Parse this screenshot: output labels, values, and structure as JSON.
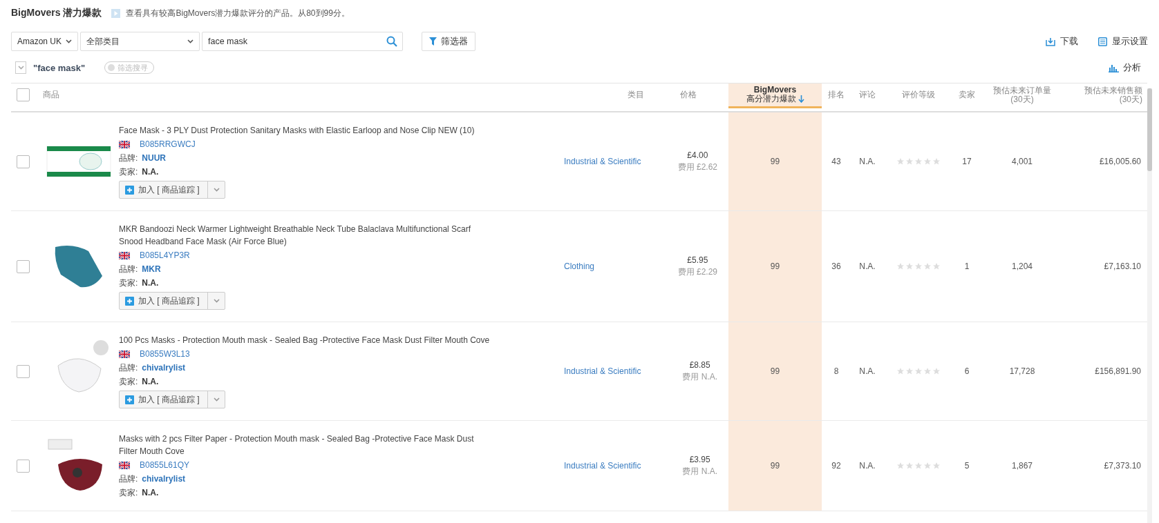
{
  "header": {
    "title": "BigMovers 潜力爆款",
    "info": "查看具有较高BigMovers潜力爆款评分的产品。从80到99分。"
  },
  "toolbar": {
    "marketplace": "Amazon UK",
    "category": "全部类目",
    "search": {
      "value": "face mask"
    },
    "filter_button": "筛选器",
    "download": "下载",
    "display_settings": "显示设置"
  },
  "filter_bar": {
    "keyword": "\"face mask\"",
    "saved_search": {
      "label": "筛选搜寻",
      "disabled": true
    },
    "analyze": "分析"
  },
  "table": {
    "select_all": {
      "checked": false
    },
    "columns": [
      {
        "label": "商品",
        "sorted": false
      },
      {
        "label": "类目",
        "sorted": false
      },
      {
        "label": "价格",
        "sorted": false
      },
      {
        "label": "BigMovers",
        "sublabel": "高分潜力爆款",
        "sorted": true
      },
      {
        "label": "排名",
        "sorted": false
      },
      {
        "label": "评论",
        "sorted": false
      },
      {
        "label": "评价等级",
        "sorted": false
      },
      {
        "label": "卖家",
        "sorted": false
      },
      {
        "label": "预估未来订单量",
        "sublabel": "(30天)",
        "sorted": false
      },
      {
        "label": "预估未来销售额",
        "sublabel": "(30天)",
        "sorted": false
      }
    ],
    "rows": [
      {
        "checked": false,
        "kind": "box",
        "title": "Face Mask - 3 PLY Dust Protection Sanitary Masks with Elastic Earloop and Nose Clip NEW (10)",
        "asin": "B085RRGWCJ",
        "brand_label": "品牌:",
        "brand": "NUUR",
        "seller_label": "卖家:",
        "seller": "N.A.",
        "track_button": "加入 [ 商品追踪 ]",
        "category": "Industrial & Scientific",
        "price": "£4.00",
        "fee": "费用 £2.62",
        "score": "99",
        "rank": "43",
        "reviews": "N.A.",
        "stars": 0,
        "sellers": "17",
        "orders": "4,001",
        "sales": "£16,005.60"
      },
      {
        "checked": false,
        "kind": "gaiter",
        "title": "MKR Bandoozi Neck Warmer Lightweight Breathable Neck Tube Balaclava Multifunctional Scarf Snood Headband Face Mask (Air Force Blue)",
        "asin": "B085L4YP3R",
        "brand_label": "品牌:",
        "brand": "MKR",
        "seller_label": "卖家:",
        "seller": "N.A.",
        "track_button": "加入 [ 商品追踪 ]",
        "category": "Clothing",
        "price": "£5.95",
        "fee": "费用 £2.29",
        "score": "99",
        "rank": "36",
        "reviews": "N.A.",
        "stars": 0,
        "sellers": "1",
        "orders": "1,204",
        "sales": "£7,163.10"
      },
      {
        "checked": false,
        "kind": "respirator",
        "title": "100 Pcs Masks - Protection Mouth mask - Sealed Bag -Protective Face Mask Dust Filter Mouth Cove",
        "asin": "B0855W3L13",
        "brand_label": "品牌:",
        "brand": "chivalrylist",
        "seller_label": "卖家:",
        "seller": "N.A.",
        "track_button": "加入 [ 商品追踪 ]",
        "category": "Industrial & Scientific",
        "price": "£8.85",
        "fee": "费用 N.A.",
        "score": "99",
        "rank": "8",
        "reviews": "N.A.",
        "stars": 0,
        "sellers": "6",
        "orders": "17,728",
        "sales": "£156,891.90"
      },
      {
        "checked": false,
        "kind": "valve",
        "title": "Masks with 2 pcs Filter Paper - Protection Mouth mask - Sealed Bag -Protective Face Mask Dust Filter Mouth Cove",
        "asin": "B0855L61QY",
        "brand_label": "品牌:",
        "brand": "chivalrylist",
        "seller_label": "卖家:",
        "seller": "N.A.",
        "category": "Industrial & Scientific",
        "price": "£3.95",
        "fee": "费用 N.A.",
        "score": "99",
        "rank": "92",
        "reviews": "N.A.",
        "stars": 0,
        "sellers": "5",
        "orders": "1,867",
        "sales": "£7,373.10"
      }
    ]
  }
}
